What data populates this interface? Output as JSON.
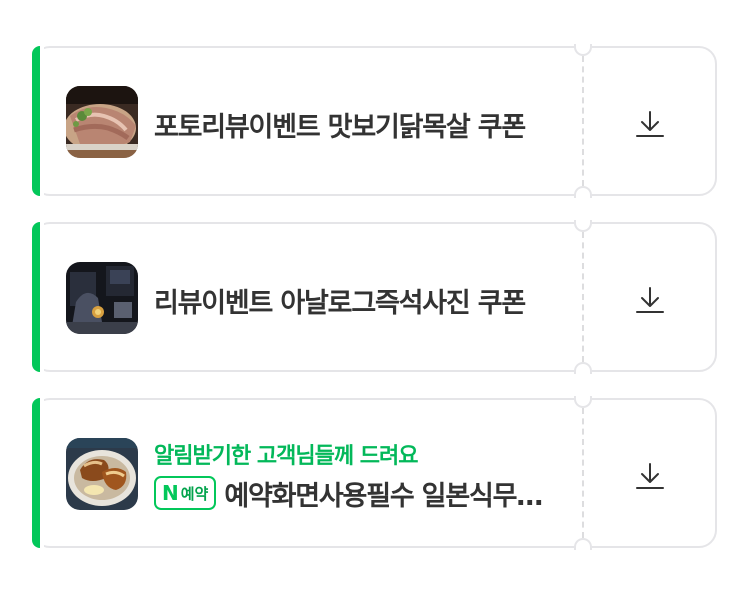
{
  "coupons": [
    {
      "title": "포토리뷰이벤트 맛보기닭목살 쿠폰",
      "thumb_icon": "grilled-meat-photo",
      "download_icon": "download-icon"
    },
    {
      "title": "리뷰이벤트 아날로그즉석사진 쿠폰",
      "thumb_icon": "photo-booth-photo",
      "download_icon": "download-icon"
    },
    {
      "subtitle": "알림받기한 고객님들께 드려요",
      "badge_letter": "N",
      "badge_text": "예약",
      "title": "예약화면사용필수 일본식무…",
      "thumb_icon": "braised-pork-photo",
      "download_icon": "download-icon"
    }
  ],
  "colors": {
    "accent": "#03c75a",
    "text": "#333333",
    "border": "#e5e5e8"
  }
}
